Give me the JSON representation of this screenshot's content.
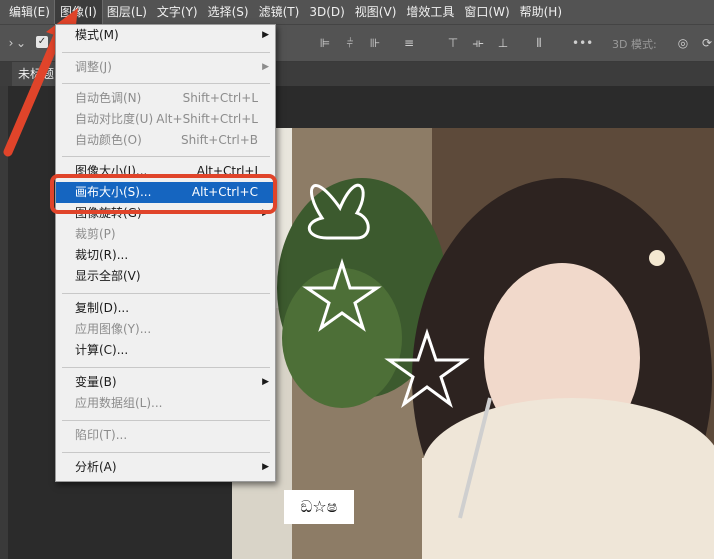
{
  "menubar": {
    "items": [
      "编辑(E)",
      "图像(I)",
      "图层(L)",
      "文字(Y)",
      "选择(S)",
      "滤镜(T)",
      "3D(D)",
      "视图(V)",
      "增效工具",
      "窗口(W)",
      "帮助(H)"
    ],
    "active_item": "图像(I)"
  },
  "options": {
    "mode3d_label": "3D 模式:"
  },
  "tab": {
    "label": "未标题"
  },
  "image_menu": {
    "items": [
      {
        "label": "模式(M)",
        "shortcut": "",
        "submenu": true,
        "disabled": false
      },
      {
        "label": "调整(J)",
        "shortcut": "",
        "submenu": true,
        "disabled": true
      },
      {
        "label": "自动色调(N)",
        "shortcut": "Shift+Ctrl+L",
        "submenu": false,
        "disabled": true
      },
      {
        "label": "自动对比度(U)",
        "shortcut": "Alt+Shift+Ctrl+L",
        "submenu": false,
        "disabled": true
      },
      {
        "label": "自动颜色(O)",
        "shortcut": "Shift+Ctrl+B",
        "submenu": false,
        "disabled": true
      },
      {
        "label": "图像大小(I)...",
        "shortcut": "Alt+Ctrl+I",
        "submenu": false,
        "disabled": false
      },
      {
        "label": "画布大小(S)...",
        "shortcut": "Alt+Ctrl+C",
        "submenu": false,
        "disabled": false,
        "highlighted": true
      },
      {
        "label": "图像旋转(G)",
        "shortcut": "",
        "submenu": true,
        "disabled": false
      },
      {
        "label": "裁剪(P)",
        "shortcut": "",
        "submenu": false,
        "disabled": true
      },
      {
        "label": "裁切(R)...",
        "shortcut": "",
        "submenu": false,
        "disabled": false
      },
      {
        "label": "显示全部(V)",
        "shortcut": "",
        "submenu": false,
        "disabled": false
      },
      {
        "label": "复制(D)...",
        "shortcut": "",
        "submenu": false,
        "disabled": false
      },
      {
        "label": "应用图像(Y)...",
        "shortcut": "",
        "submenu": false,
        "disabled": true
      },
      {
        "label": "计算(C)...",
        "shortcut": "",
        "submenu": false,
        "disabled": false
      },
      {
        "label": "变量(B)",
        "shortcut": "",
        "submenu": true,
        "disabled": false
      },
      {
        "label": "应用数据组(L)...",
        "shortcut": "",
        "submenu": false,
        "disabled": true
      },
      {
        "label": "陷印(T)...",
        "shortcut": "",
        "submenu": false,
        "disabled": true
      },
      {
        "label": "分析(A)",
        "shortcut": "",
        "submenu": true,
        "disabled": false
      }
    ]
  },
  "canvas": {
    "sticker_text": "ඞ☆ෂ"
  },
  "colors": {
    "highlight": "#1565c0",
    "annotation": "#e0442a",
    "menu_bg": "#f0f0f0",
    "app_bg": "#535353"
  }
}
